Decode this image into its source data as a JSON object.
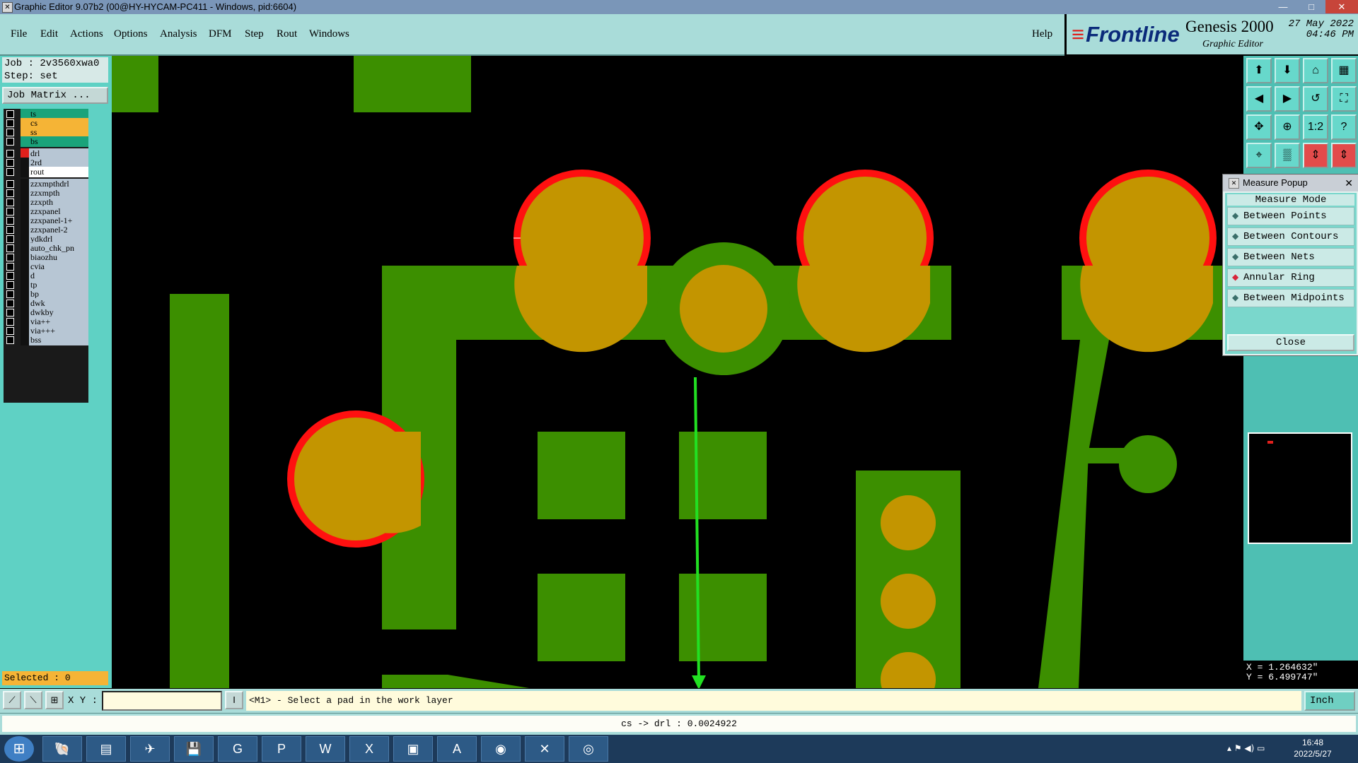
{
  "window": {
    "title": "Graphic Editor 9.07b2 (00@HY-HYCAM-PC411 - Windows, pid:6604)"
  },
  "menu": {
    "items": [
      "File",
      "Edit",
      "Actions",
      "Options",
      "Analysis",
      "DFM",
      "Step",
      "Rout",
      "Windows"
    ],
    "help": "Help"
  },
  "brand": {
    "logo": "Frontline",
    "product": "Genesis 2000",
    "subtitle": "Graphic Editor",
    "date": "27 May 2022",
    "time": "04:46 PM"
  },
  "job": {
    "job_line": "Job : 2v3560xwa0",
    "step_line": "Step: set",
    "matrix_button": "Job Matrix ..."
  },
  "layers": [
    {
      "name": "ts",
      "color": "#1aa37a"
    },
    {
      "name": "cs",
      "color": "#f5b436"
    },
    {
      "name": "ss",
      "color": "#f5b436"
    },
    {
      "name": "bs",
      "color": "#1aa37a"
    },
    {
      "name": "drl",
      "color": "#b7c6d4"
    },
    {
      "name": "2rd",
      "color": "#b7c6d4"
    },
    {
      "name": "rout",
      "color": "#ffffff"
    },
    {
      "name": "zzxmpthdrl",
      "color": "#b7c6d4"
    },
    {
      "name": "zzxmpth",
      "color": "#b7c6d4"
    },
    {
      "name": "zzxpth",
      "color": "#b7c6d4"
    },
    {
      "name": "zzxpanel",
      "color": "#b7c6d4"
    },
    {
      "name": "zzxpanel-1+",
      "color": "#b7c6d4"
    },
    {
      "name": "zzxpanel-2",
      "color": "#b7c6d4"
    },
    {
      "name": "ydkdrl",
      "color": "#b7c6d4"
    },
    {
      "name": "auto_chk_pn",
      "color": "#b7c6d4"
    },
    {
      "name": "biaozhu",
      "color": "#b7c6d4"
    },
    {
      "name": "cvia",
      "color": "#b7c6d4"
    },
    {
      "name": "d",
      "color": "#b7c6d4"
    },
    {
      "name": "tp",
      "color": "#b7c6d4"
    },
    {
      "name": "bp",
      "color": "#b7c6d4"
    },
    {
      "name": "dwk",
      "color": "#b7c6d4"
    },
    {
      "name": "dwkby",
      "color": "#b7c6d4"
    },
    {
      "name": "via++",
      "color": "#b7c6d4"
    },
    {
      "name": "via+++",
      "color": "#b7c6d4"
    },
    {
      "name": "bss",
      "color": "#b7c6d4"
    }
  ],
  "selected": "Selected : 0",
  "toolbar": {
    "icons": [
      "zoom-in-icon",
      "zoom-out-icon",
      "home-icon",
      "split-view-icon",
      "pan-left-icon",
      "pan-right-icon",
      "undo-view-icon",
      "fullscreen-icon",
      "fit-icon",
      "fit-all-icon",
      "scale-icon",
      "help-icon",
      "snap-icon",
      "grid-icon",
      "measure-icon",
      "measure-alt-icon"
    ],
    "scale_label": "1:2",
    "help_label": "?"
  },
  "measure_popup": {
    "title": "Measure Popup",
    "mode_title": "Measure Mode",
    "options": [
      "Between Points",
      "Between Contours",
      "Between Nets",
      "Annular Ring",
      "Between Midpoints"
    ],
    "active": "Annular Ring",
    "close": "Close"
  },
  "coords": {
    "x": "X = 1.264632\"",
    "y": "Y = 6.499747\""
  },
  "status": {
    "xy_label": "X Y :",
    "xy_value": "",
    "prompt": "<M1> - Select a pad in the work layer",
    "unit": "Inch"
  },
  "message": "cs -> drl : 0.0024922",
  "taskbar": {
    "time": "16:48",
    "date": "2022/5/27"
  },
  "colors": {
    "copper": "#3c8f00",
    "pad": "#c39500",
    "drill": "#ff1010",
    "measure": "#22e022"
  }
}
